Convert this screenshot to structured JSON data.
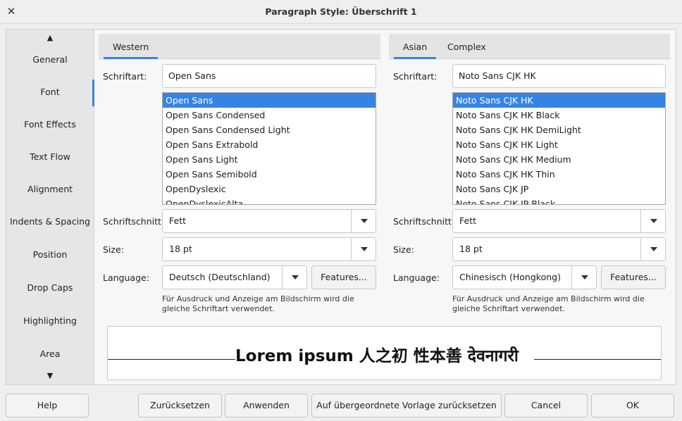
{
  "window": {
    "title": "Paragraph Style: Überschrift 1"
  },
  "sidebar": {
    "scroll_up": "▲",
    "scroll_down": "▼",
    "items": [
      {
        "label": "General"
      },
      {
        "label": "Font"
      },
      {
        "label": "Font Effects"
      },
      {
        "label": "Text Flow"
      },
      {
        "label": "Alignment"
      },
      {
        "label": "Indents & Spacing"
      },
      {
        "label": "Position"
      },
      {
        "label": "Drop Caps"
      },
      {
        "label": "Highlighting"
      },
      {
        "label": "Area"
      }
    ],
    "active": "Font"
  },
  "western": {
    "tab": "Western",
    "font_label": "Schriftart:",
    "font_value": "Open Sans",
    "font_list": [
      "Open Sans",
      "Open Sans Condensed",
      "Open Sans Condensed Light",
      "Open Sans Extrabold",
      "Open Sans Light",
      "Open Sans Semibold",
      "OpenDyslexic",
      "OpenDyslexicAlta"
    ],
    "style_label": "Schriftschnitt:",
    "style_value": "Fett",
    "size_label": "Size:",
    "size_value": "18 pt",
    "language_label": "Language:",
    "language_value": "Deutsch (Deutschland)",
    "features_button": "Features...",
    "note": "Für Ausdruck und Anzeige am Bildschirm wird die gleiche Schriftart verwendet."
  },
  "asian": {
    "tabs": [
      "Asian",
      "Complex"
    ],
    "font_label": "Schriftart:",
    "font_value": "Noto Sans CJK HK",
    "font_list": [
      "Noto Sans CJK HK",
      "Noto Sans CJK HK Black",
      "Noto Sans CJK HK DemiLight",
      "Noto Sans CJK HK Light",
      "Noto Sans CJK HK Medium",
      "Noto Sans CJK HK Thin",
      "Noto Sans CJK JP",
      "Noto Sans CJK JP Black"
    ],
    "style_label": "Schriftschnitt:",
    "style_value": "Fett",
    "size_label": "Size:",
    "size_value": "18 pt",
    "language_label": "Language:",
    "language_value": "Chinesisch (Hongkong)",
    "features_button": "Features...",
    "note": "Für Ausdruck und Anzeige am Bildschirm wird die gleiche Schriftart verwendet."
  },
  "preview": {
    "text": "Lorem ipsum   人之初 性本善   देवनागरी"
  },
  "footer": {
    "help": "Help",
    "reset": "Zurücksetzen",
    "apply": "Anwenden",
    "reset_parent": "Auf übergeordnete Vorlage zurücksetzen",
    "cancel": "Cancel",
    "ok": "OK"
  },
  "colors": {
    "accent": "#3584e4"
  }
}
